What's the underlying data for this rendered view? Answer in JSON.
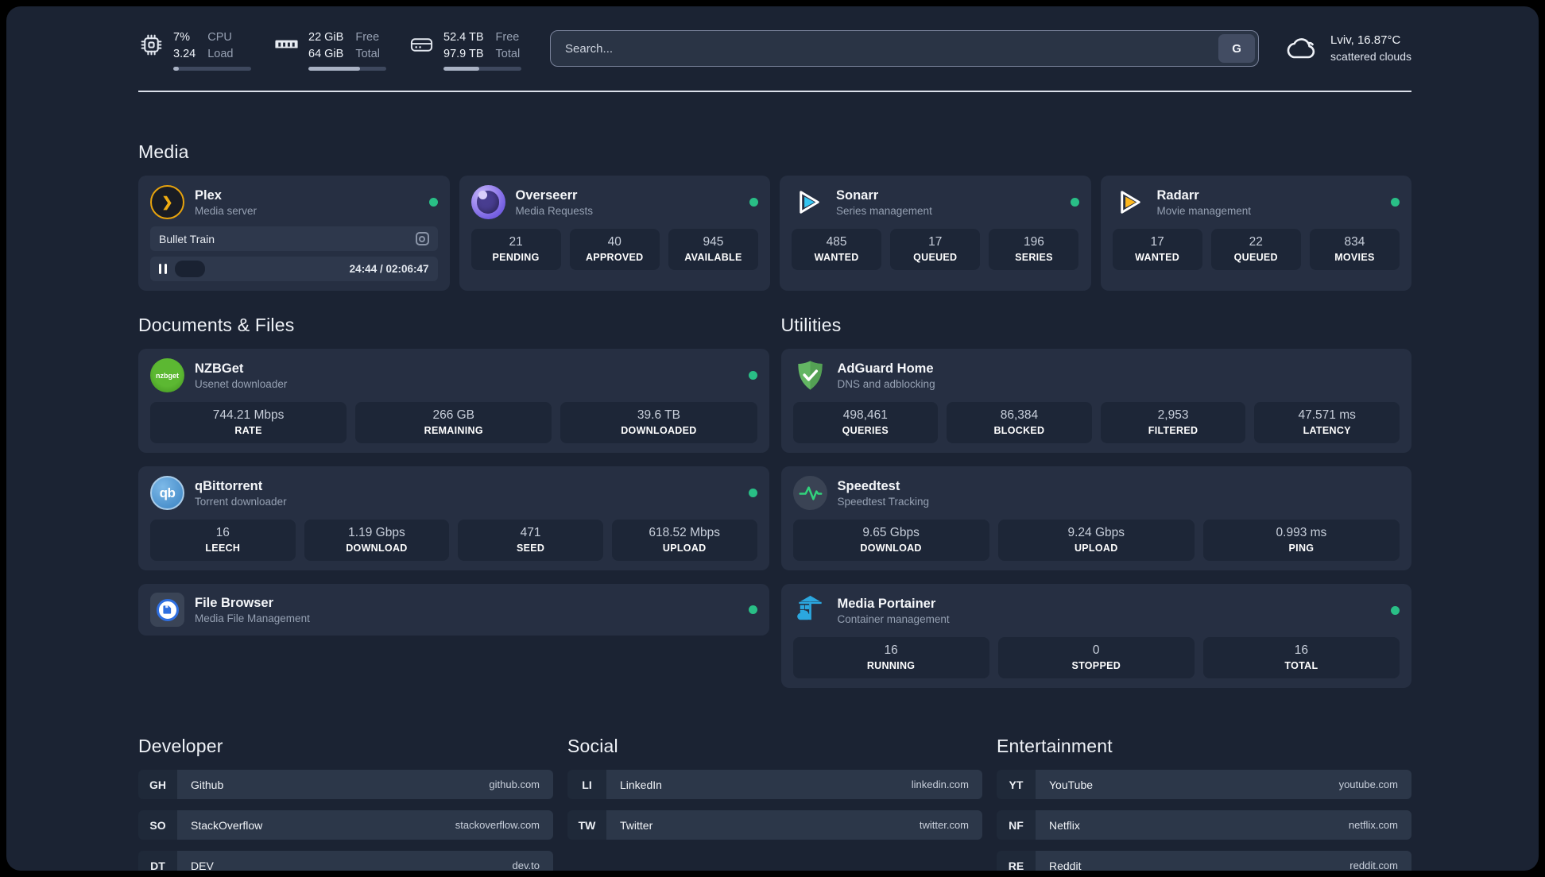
{
  "colors": {
    "accent_green": "#29bf86",
    "page_bg": "#1b2333",
    "card_bg": "#262f42",
    "pill_bg": "#1d2637"
  },
  "header": {
    "stats": [
      {
        "icon": "cpu-icon",
        "values": [
          "7%",
          "3.24"
        ],
        "labels": [
          "CPU",
          "Load"
        ],
        "progress_pct": 7
      },
      {
        "icon": "ram-icon",
        "values": [
          "22 GiB",
          "64 GiB"
        ],
        "labels": [
          "Free",
          "Total"
        ],
        "progress_pct": 66
      },
      {
        "icon": "disk-icon",
        "values": [
          "52.4 TB",
          "97.9 TB"
        ],
        "labels": [
          "Free",
          "Total"
        ],
        "progress_pct": 46
      }
    ],
    "search": {
      "placeholder": "Search...",
      "button_label": "G"
    },
    "weather": {
      "icon": "cloud-icon",
      "location": "Lviv, 16.87°C",
      "condition": "scattered clouds"
    }
  },
  "sections": {
    "media": {
      "title": "Media",
      "cards": [
        {
          "name": "Plex",
          "subtitle": "Media server",
          "icon": "plex-icon",
          "icon_glyph": "❯",
          "status": "online",
          "player": {
            "title": "Bullet Train",
            "time": "24:44 / 02:06:47",
            "progress_pct": 18
          }
        },
        {
          "name": "Overseerr",
          "subtitle": "Media Requests",
          "icon": "overseerr-icon",
          "status": "online",
          "stats": [
            {
              "value": "21",
              "label": "PENDING"
            },
            {
              "value": "40",
              "label": "APPROVED"
            },
            {
              "value": "945",
              "label": "AVAILABLE"
            }
          ]
        },
        {
          "name": "Sonarr",
          "subtitle": "Series management",
          "icon": "sonarr-icon",
          "status": "online",
          "stats": [
            {
              "value": "485",
              "label": "WANTED"
            },
            {
              "value": "17",
              "label": "QUEUED"
            },
            {
              "value": "196",
              "label": "SERIES"
            }
          ]
        },
        {
          "name": "Radarr",
          "subtitle": "Movie management",
          "icon": "radarr-icon",
          "status": "online",
          "stats": [
            {
              "value": "17",
              "label": "WANTED"
            },
            {
              "value": "22",
              "label": "QUEUED"
            },
            {
              "value": "834",
              "label": "MOVIES"
            }
          ]
        }
      ]
    },
    "documents": {
      "title": "Documents & Files",
      "cards": [
        {
          "name": "NZBGet",
          "subtitle": "Usenet downloader",
          "icon": "nzbget-icon",
          "icon_text": "nzbget",
          "status": "online",
          "stats": [
            {
              "value": "744.21 Mbps",
              "label": "RATE"
            },
            {
              "value": "266 GB",
              "label": "REMAINING"
            },
            {
              "value": "39.6 TB",
              "label": "DOWNLOADED"
            }
          ]
        },
        {
          "name": "qBittorrent",
          "subtitle": "Torrent downloader",
          "icon": "qbittorrent-icon",
          "icon_text": "qb",
          "status": "online",
          "stats": [
            {
              "value": "16",
              "label": "LEECH"
            },
            {
              "value": "1.19 Gbps",
              "label": "DOWNLOAD"
            },
            {
              "value": "471",
              "label": "SEED"
            },
            {
              "value": "618.52 Mbps",
              "label": "UPLOAD"
            }
          ]
        },
        {
          "name": "File Browser",
          "subtitle": "Media File Management",
          "icon": "filebrowser-icon",
          "status": "online"
        }
      ]
    },
    "utilities": {
      "title": "Utilities",
      "cards": [
        {
          "name": "AdGuard Home",
          "subtitle": "DNS and adblocking",
          "icon": "adguard-icon",
          "stats": [
            {
              "value": "498,461",
              "label": "QUERIES"
            },
            {
              "value": "86,384",
              "label": "BLOCKED"
            },
            {
              "value": "2,953",
              "label": "FILTERED"
            },
            {
              "value": "47.571 ms",
              "label": "LATENCY"
            }
          ]
        },
        {
          "name": "Speedtest",
          "subtitle": "Speedtest Tracking",
          "icon": "speedtest-icon",
          "stats": [
            {
              "value": "9.65 Gbps",
              "label": "DOWNLOAD"
            },
            {
              "value": "9.24 Gbps",
              "label": "UPLOAD"
            },
            {
              "value": "0.993 ms",
              "label": "PING"
            }
          ]
        },
        {
          "name": "Media Portainer",
          "subtitle": "Container management",
          "icon": "portainer-icon",
          "status": "online",
          "stats": [
            {
              "value": "16",
              "label": "RUNNING"
            },
            {
              "value": "0",
              "label": "STOPPED"
            },
            {
              "value": "16",
              "label": "TOTAL"
            }
          ]
        }
      ]
    },
    "link_groups": [
      {
        "title": "Developer",
        "links": [
          {
            "prefix": "GH",
            "name": "Github",
            "url": "github.com"
          },
          {
            "prefix": "SO",
            "name": "StackOverflow",
            "url": "stackoverflow.com"
          },
          {
            "prefix": "DT",
            "name": "DEV",
            "url": "dev.to"
          }
        ]
      },
      {
        "title": "Social",
        "links": [
          {
            "prefix": "LI",
            "name": "LinkedIn",
            "url": "linkedin.com"
          },
          {
            "prefix": "TW",
            "name": "Twitter",
            "url": "twitter.com"
          }
        ]
      },
      {
        "title": "Entertainment",
        "links": [
          {
            "prefix": "YT",
            "name": "YouTube",
            "url": "youtube.com"
          },
          {
            "prefix": "NF",
            "name": "Netflix",
            "url": "netflix.com"
          },
          {
            "prefix": "RE",
            "name": "Reddit",
            "url": "reddit.com"
          }
        ]
      }
    ]
  }
}
